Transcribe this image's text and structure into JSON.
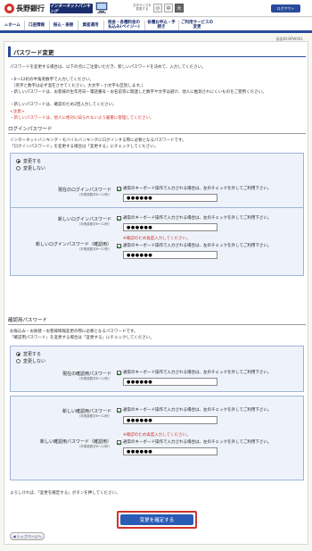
{
  "header": {
    "bank_name": "長野銀行",
    "ib_banner": "インターネットバンキング",
    "size_label_1": "文字サイズを",
    "size_label_2": "変更する",
    "size_small": "小",
    "size_medium": "中",
    "size_large": "大",
    "logout": "ログアウト"
  },
  "nav": {
    "items": [
      {
        "label": "ホーム"
      },
      {
        "label": "口座情報"
      },
      {
        "label": "振込・振替"
      },
      {
        "label": "資産運用"
      },
      {
        "label": "税金・各種料金の払込み(ペイジー)"
      },
      {
        "label": "各種お申込・手続き"
      },
      {
        "label": "ご利用サービスの変更"
      }
    ]
  },
  "screen_id": "画面ID:BPW001",
  "page_title": "パスワード変更",
  "intro": {
    "line1": "パスワードを変更する場合は、以下の点にご注意いただき、新しいパスワードを決めて、入力してください。",
    "bullet1": "・6～12桁の半角英数字で入力してください。",
    "bullet1b": "（英字と数字は必ず混在させてください。大文字・小文字も区別します。）",
    "bullet2": "・新しいパスワードは、お客様の生年月日・電話番号・お名前等に関連した数字や文字は避け、他人に推測されにくいものをご使用ください。",
    "bullet3": "・新しいパスワードは、確認のため2回入力してください。",
    "caution_title": "<注意>",
    "caution": "・新しいパスワードは、他人に絶対に知られないよう厳重に管理してください。"
  },
  "login_section": {
    "title": "ログインパスワード",
    "desc1": "インターネットバンキング・モバイルバンキングにログインする際に必要となるパスワードです。",
    "desc2": "「ログインパスワード」を変更する場合は「変更する」にチェックしてください。",
    "radio_change": "変更する",
    "radio_nochange": "変更しない",
    "current_label": "現在のログインパスワード",
    "current_sub": "（半角英数字6～12桁）",
    "new_label": "新しいログインパスワード",
    "new_sub": "（半角英数字6～12桁）",
    "confirm_label": "新しいログインパスワード（確認用）",
    "confirm_sub": "（半角英数字6～12桁）",
    "confirm_note": "※確認のため再度入力してください。",
    "checkbox_text": "通常のキーボード操作で入力される場合は、左のチェックを外してご利用下さい。",
    "masked": "●●●●●●"
  },
  "verify_section": {
    "title": "確認用パスワード",
    "desc1": "お振込み・お振替・お客様情報変更の際に必要となるパスワードです。",
    "desc2": "「確認用パスワード」を変更する場合は「変更する」にチェックしてください。",
    "radio_change": "変更する",
    "radio_nochange": "変更しない",
    "current_label": "現在の確認用パスワード",
    "current_sub": "（半角英数字6～12桁）",
    "new_label": "新しい確認用パスワード",
    "new_sub": "（半角英数字6～12桁）",
    "confirm_label": "新しい確認用パスワード（確認用）",
    "confirm_sub": "（半角英数字6～12桁）",
    "confirm_note": "※確認のため再度入力してください。",
    "checkbox_text": "通常のキーボード操作で入力される場合は、左のチェックを外してご利用下さい。",
    "masked": "●●●●●●"
  },
  "footer_note": "よろしければ、「変更を確定する」ボタンを押してください。",
  "submit_label": "変更を確定する",
  "top_page_label": "トップページへ"
}
